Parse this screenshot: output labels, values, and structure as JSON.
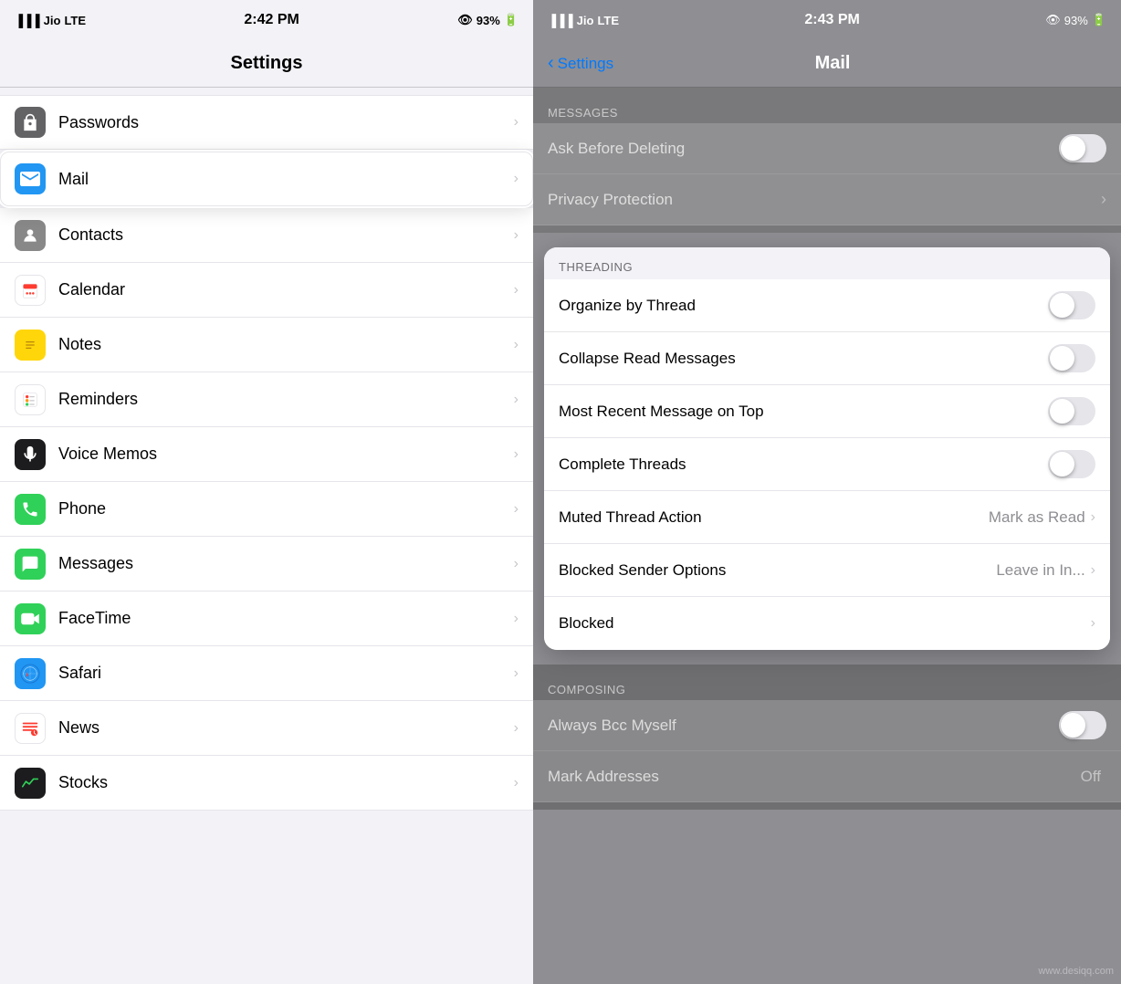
{
  "left": {
    "statusBar": {
      "carrier": "Jio",
      "network": "LTE",
      "time": "2:42 PM",
      "battery": "93%"
    },
    "title": "Settings",
    "items": [
      {
        "id": "passwords",
        "label": "Passwords",
        "iconBg": "icon-passwords",
        "iconSymbol": "🔑",
        "hasChevron": true,
        "highlighted": false
      },
      {
        "id": "mail",
        "label": "Mail",
        "iconBg": "icon-mail",
        "iconSymbol": "✉",
        "hasChevron": true,
        "highlighted": true
      },
      {
        "id": "contacts",
        "label": "Contacts",
        "iconBg": "icon-contacts",
        "iconSymbol": "👤",
        "hasChevron": true,
        "highlighted": false
      },
      {
        "id": "calendar",
        "label": "Calendar",
        "iconBg": "icon-calendar",
        "iconSymbol": "📅",
        "hasChevron": true,
        "highlighted": false
      },
      {
        "id": "notes",
        "label": "Notes",
        "iconBg": "icon-notes",
        "iconSymbol": "📝",
        "hasChevron": true,
        "highlighted": false
      },
      {
        "id": "reminders",
        "label": "Reminders",
        "iconBg": "icon-reminders",
        "iconSymbol": "📋",
        "hasChevron": true,
        "highlighted": false
      },
      {
        "id": "voicememos",
        "label": "Voice Memos",
        "iconBg": "icon-voicememos",
        "iconSymbol": "🎙",
        "hasChevron": true,
        "highlighted": false
      },
      {
        "id": "phone",
        "label": "Phone",
        "iconBg": "icon-phone",
        "iconSymbol": "📞",
        "hasChevron": true,
        "highlighted": false
      },
      {
        "id": "messages",
        "label": "Messages",
        "iconBg": "icon-messages",
        "iconSymbol": "💬",
        "hasChevron": true,
        "highlighted": false
      },
      {
        "id": "facetime",
        "label": "FaceTime",
        "iconBg": "icon-facetime",
        "iconSymbol": "📹",
        "hasChevron": true,
        "highlighted": false
      },
      {
        "id": "safari",
        "label": "Safari",
        "iconBg": "icon-safari",
        "iconSymbol": "🧭",
        "hasChevron": true,
        "highlighted": false
      },
      {
        "id": "news",
        "label": "News",
        "iconBg": "icon-news",
        "iconSymbol": "📰",
        "hasChevron": true,
        "highlighted": false
      },
      {
        "id": "stocks",
        "label": "Stocks",
        "iconBg": "icon-stocks",
        "iconSymbol": "📈",
        "hasChevron": true,
        "highlighted": false
      }
    ]
  },
  "right": {
    "statusBar": {
      "carrier": "Jio",
      "network": "LTE",
      "time": "2:43 PM",
      "battery": "93%"
    },
    "backLabel": "Settings",
    "title": "Mail",
    "topItems": [
      {
        "id": "messages-header",
        "type": "section-header",
        "label": "MESSAGES"
      },
      {
        "id": "ask-before-deleting",
        "label": "Ask Before Deleting",
        "type": "toggle",
        "value": false
      },
      {
        "id": "privacy-protection",
        "label": "Privacy Protection",
        "type": "chevron"
      }
    ],
    "threadingSection": {
      "header": "THREADING",
      "items": [
        {
          "id": "organize-by-thread",
          "label": "Organize by Thread",
          "type": "toggle",
          "value": false
        },
        {
          "id": "collapse-read-messages",
          "label": "Collapse Read Messages",
          "type": "toggle",
          "value": false
        },
        {
          "id": "most-recent-on-top",
          "label": "Most Recent Message on Top",
          "type": "toggle",
          "value": false
        },
        {
          "id": "complete-threads",
          "label": "Complete Threads",
          "type": "toggle",
          "value": false
        },
        {
          "id": "muted-thread-action",
          "label": "Muted Thread Action",
          "type": "value-chevron",
          "value": "Mark as Read"
        },
        {
          "id": "blocked-sender-options",
          "label": "Blocked Sender Options",
          "type": "value-chevron",
          "value": "Leave in In..."
        },
        {
          "id": "blocked",
          "label": "Blocked",
          "type": "chevron"
        }
      ]
    },
    "composingSection": {
      "header": "COMPOSING",
      "items": [
        {
          "id": "always-bcc-myself",
          "label": "Always Bcc Myself",
          "type": "toggle",
          "value": false
        },
        {
          "id": "mark-addresses",
          "label": "Mark Addresses",
          "type": "value",
          "value": "Off"
        }
      ]
    },
    "watermark": "www.desiqq.com"
  }
}
